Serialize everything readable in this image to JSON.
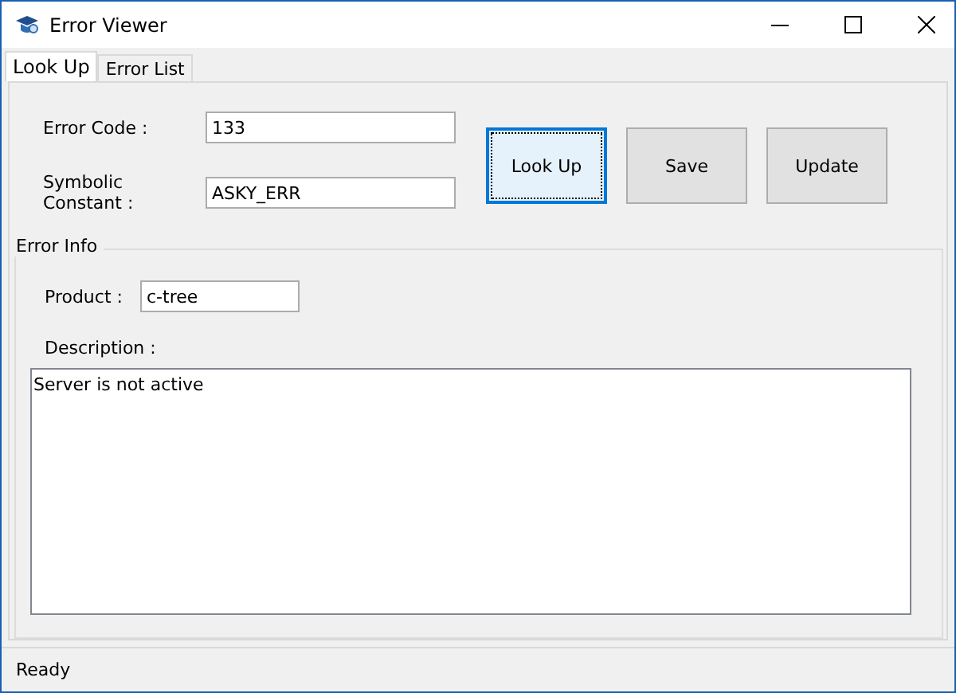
{
  "window": {
    "title": "Error Viewer"
  },
  "tabs": [
    {
      "label": "Look Up",
      "selected": true
    },
    {
      "label": "Error List",
      "selected": false
    }
  ],
  "lookup": {
    "fields": [
      {
        "label": "Error Code :",
        "value": "133"
      },
      {
        "label": "Symbolic Constant :",
        "value": "ASKY_ERR"
      }
    ],
    "buttons": [
      {
        "label": "Look Up",
        "focused": true
      },
      {
        "label": "Save",
        "focused": false
      },
      {
        "label": "Update",
        "focused": false
      }
    ]
  },
  "error_info": {
    "title": "Error Info",
    "product": {
      "label": "Product :",
      "value": "c-tree"
    },
    "description": {
      "label": "Description :",
      "value": "Server is not active"
    }
  },
  "status_bar": "Ready"
}
